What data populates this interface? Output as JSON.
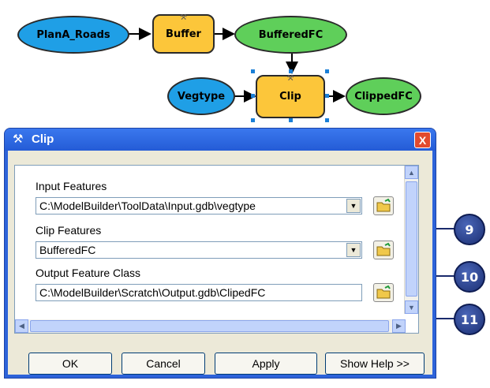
{
  "model": {
    "input_roads": "PlanA_Roads",
    "buffer_tool": "Buffer",
    "buffered_fc": "BufferedFC",
    "vegtype": "Vegtype",
    "clip_tool": "Clip",
    "clipped_fc": "ClippedFC"
  },
  "dialog": {
    "title": "Clip",
    "close_label": "X",
    "input_features_label": "Input Features",
    "input_features_value": "C:\\ModelBuilder\\ToolData\\Input.gdb\\vegtype",
    "clip_features_label": "Clip Features",
    "clip_features_value": "BufferedFC",
    "output_label": "Output Feature Class",
    "output_value": "C:\\ModelBuilder\\Scratch\\Output.gdb\\ClipedFC",
    "buttons": {
      "ok": "OK",
      "cancel": "Cancel",
      "apply": "Apply",
      "help": "Show Help >>"
    }
  },
  "callouts": [
    "9",
    "10",
    "11"
  ]
}
